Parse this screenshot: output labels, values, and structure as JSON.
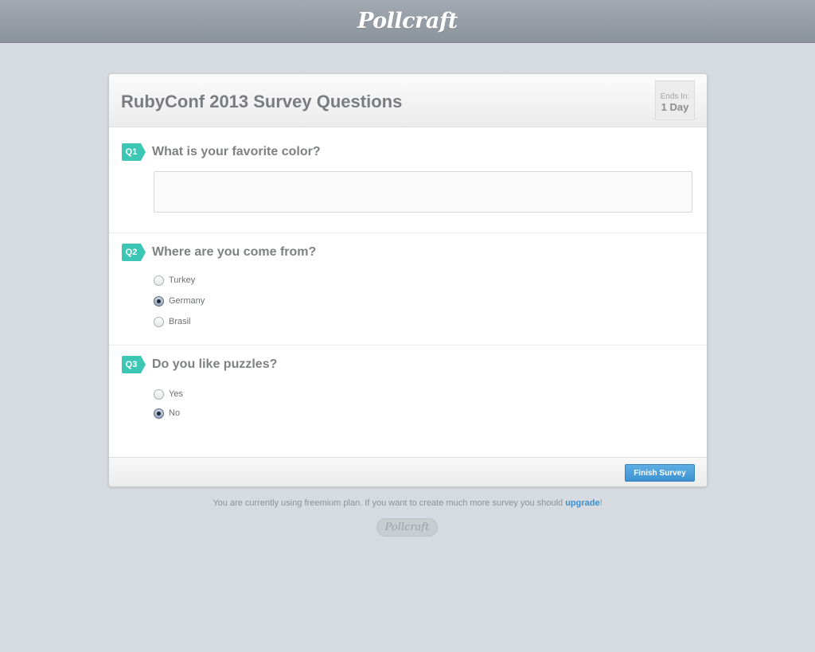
{
  "app": {
    "brand": "Pollcraft"
  },
  "survey": {
    "title": "RubyConf 2013 Survey Questions",
    "ends_label": "Ends In:",
    "ends_value": "1 Day"
  },
  "questions": [
    {
      "badge": "Q1",
      "text": "What is your favorite color?",
      "type": "text",
      "value": "",
      "placeholder": ""
    },
    {
      "badge": "Q2",
      "text": "Where are you come from?",
      "type": "radio",
      "options": [
        {
          "label": "Turkey",
          "checked": false
        },
        {
          "label": "Germany",
          "checked": true
        },
        {
          "label": "Brasil",
          "checked": false
        }
      ]
    },
    {
      "badge": "Q3",
      "text": "Do you like puzzles?",
      "type": "radio",
      "options": [
        {
          "label": "Yes",
          "checked": false
        },
        {
          "label": "No",
          "checked": true
        }
      ]
    }
  ],
  "footer": {
    "finish_label": "Finish Survey",
    "notice_text": "You are currently using freemium plan. If you want to create much more survey you should ",
    "upgrade_link": "upgrade",
    "notice_end": "!",
    "logo": "Pollcraft"
  },
  "colors": {
    "accent": "#3cc7b5",
    "button": "#4a9fdc",
    "link": "#3a8fd0",
    "background": "#d5dbe0"
  }
}
